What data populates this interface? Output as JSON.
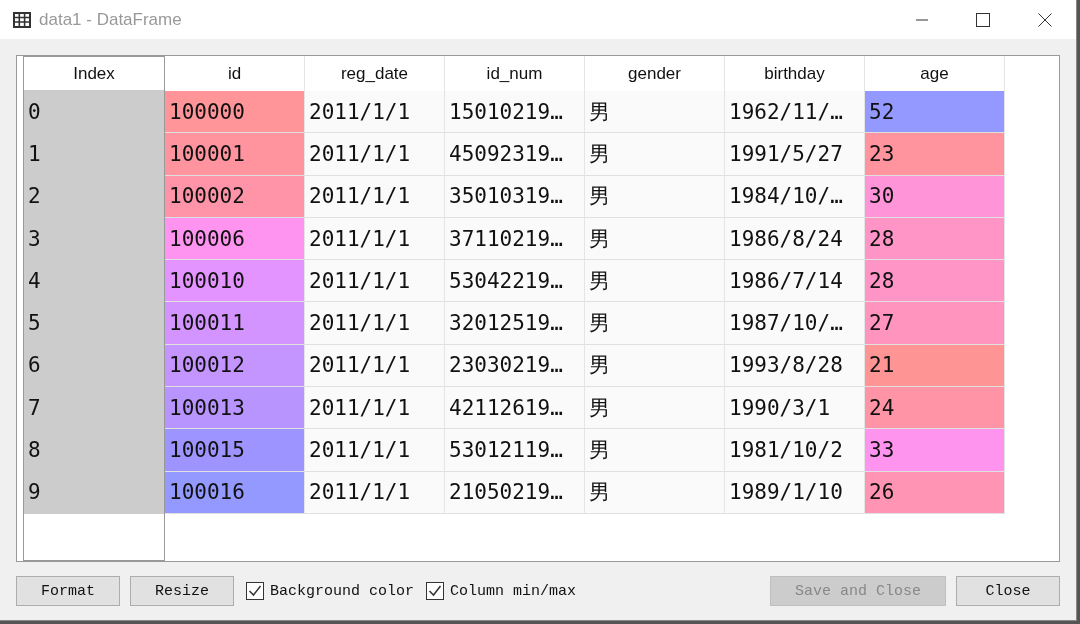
{
  "window": {
    "title": "data1 - DataFrame"
  },
  "table": {
    "index_header": "Index",
    "columns": [
      "id",
      "reg_date",
      "id_num",
      "gender",
      "birthday",
      "age"
    ],
    "rows": [
      {
        "index": "0",
        "cells": [
          {
            "text": "100000",
            "color": "#ff9499"
          },
          {
            "text": "2011/1/1"
          },
          {
            "text": "15010219…"
          },
          {
            "text": "男"
          },
          {
            "text": "1962/11/…"
          },
          {
            "text": "52",
            "color": "#9499ff"
          }
        ]
      },
      {
        "index": "1",
        "cells": [
          {
            "text": "100001",
            "color": "#ff949f"
          },
          {
            "text": "2011/1/1"
          },
          {
            "text": "45092319…"
          },
          {
            "text": "男"
          },
          {
            "text": "1991/5/27"
          },
          {
            "text": "23",
            "color": "#ff949e"
          }
        ]
      },
      {
        "index": "2",
        "cells": [
          {
            "text": "100002",
            "color": "#ff94a8"
          },
          {
            "text": "2011/1/1"
          },
          {
            "text": "35010319…"
          },
          {
            "text": "男"
          },
          {
            "text": "1984/10/…"
          },
          {
            "text": "30",
            "color": "#ff94d8"
          }
        ]
      },
      {
        "index": "3",
        "cells": [
          {
            "text": "100006",
            "color": "#ff94f0"
          },
          {
            "text": "2011/1/1"
          },
          {
            "text": "37110219…"
          },
          {
            "text": "男"
          },
          {
            "text": "1986/8/24"
          },
          {
            "text": "28",
            "color": "#ff94c6"
          }
        ]
      },
      {
        "index": "4",
        "cells": [
          {
            "text": "100010",
            "color": "#e494ff"
          },
          {
            "text": "2011/1/1"
          },
          {
            "text": "53042219…"
          },
          {
            "text": "男"
          },
          {
            "text": "1986/7/14"
          },
          {
            "text": "28",
            "color": "#ff94c6"
          }
        ]
      },
      {
        "index": "5",
        "cells": [
          {
            "text": "100011",
            "color": "#d494ff"
          },
          {
            "text": "2011/1/1"
          },
          {
            "text": "32012519…"
          },
          {
            "text": "男"
          },
          {
            "text": "1987/10/…"
          },
          {
            "text": "27",
            "color": "#ff94bf"
          }
        ]
      },
      {
        "index": "6",
        "cells": [
          {
            "text": "100012",
            "color": "#c494ff"
          },
          {
            "text": "2011/1/1"
          },
          {
            "text": "23030219…"
          },
          {
            "text": "男"
          },
          {
            "text": "1993/8/28"
          },
          {
            "text": "21",
            "color": "#ff9494"
          }
        ]
      },
      {
        "index": "7",
        "cells": [
          {
            "text": "100013",
            "color": "#b894ff"
          },
          {
            "text": "2011/1/1"
          },
          {
            "text": "42112619…"
          },
          {
            "text": "男"
          },
          {
            "text": "1990/3/1"
          },
          {
            "text": "24",
            "color": "#ff94a6"
          }
        ]
      },
      {
        "index": "8",
        "cells": [
          {
            "text": "100015",
            "color": "#9e94ff"
          },
          {
            "text": "2011/1/1"
          },
          {
            "text": "53012119…"
          },
          {
            "text": "男"
          },
          {
            "text": "1981/10/2"
          },
          {
            "text": "33",
            "color": "#ff94ef"
          }
        ]
      },
      {
        "index": "9",
        "cells": [
          {
            "text": "100016",
            "color": "#9499ff"
          },
          {
            "text": "2011/1/1"
          },
          {
            "text": "21050219…"
          },
          {
            "text": "男"
          },
          {
            "text": "1989/1/10"
          },
          {
            "text": "26",
            "color": "#ff94b4"
          }
        ]
      }
    ]
  },
  "footer": {
    "buttons": [
      {
        "label": "Format",
        "disabled": false
      },
      {
        "label": "Resize",
        "disabled": false
      }
    ],
    "checkboxes": [
      {
        "label": "Background color",
        "checked": true
      },
      {
        "label": "Column min/max",
        "checked": true
      }
    ],
    "actions": [
      {
        "label": "Save and Close",
        "disabled": true
      },
      {
        "label": "Close",
        "disabled": false
      }
    ]
  }
}
